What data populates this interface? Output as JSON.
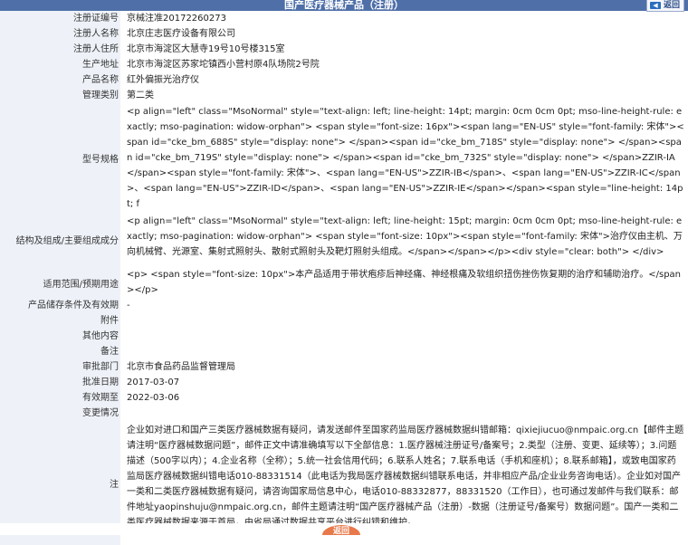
{
  "header": {
    "title": "国产医疗器械产品（注册）",
    "back_label": "返回"
  },
  "fields": {
    "reg_no": {
      "label": "注册证编号",
      "value": "京械注准20172260273"
    },
    "registrant_name": {
      "label": "注册人名称",
      "value": "北京庄志医疗设备有限公司"
    },
    "registrant_address": {
      "label": "注册人住所",
      "value": "北京市海淀区大慧寺19号10号楼315室"
    },
    "production_address": {
      "label": "生产地址",
      "value": "北京市海淀区苏家坨镇西小营村原4队场院2号院"
    },
    "product_name": {
      "label": "产品名称",
      "value": "红外偏振光治疗仪"
    },
    "category": {
      "label": "管理类别",
      "value": "第二类"
    },
    "model": {
      "label": "型号规格",
      "value": "<p align=\"left\" class=\"MsoNormal\" style=\"text-align: left; line-height: 14pt; margin: 0cm 0cm 0pt; mso-line-height-rule: exactly; mso-pagination: widow-orphan\"> <span style=\"font-size: 16px\"><span lang=\"EN-US\" style=\"font-family: 宋体\"><span id=\"cke_bm_688S\" style=\"display: none\"> </span><span id=\"cke_bm_718S\" style=\"display: none\"> </span><span id=\"cke_bm_719S\" style=\"display: none\"> </span><span id=\"cke_bm_732S\" style=\"display: none\"> </span>ZZIR-IA</span><span style=\"font-family: 宋体\">、<span lang=\"EN-US\">ZZIR-IB</span>、<span lang=\"EN-US\">ZZIR-IC</span>、<span lang=\"EN-US\">ZZIR-ID</span>、<span lang=\"EN-US\">ZZIR-IE</span></span><span style=\"line-height: 14pt; f"
    },
    "structure": {
      "label": "结构及组成/主要组成成分",
      "value": "<p align=\"left\" class=\"MsoNormal\" style=\"text-align: left; line-height: 15pt; margin: 0cm 0cm 0pt; mso-line-height-rule: exactly; mso-pagination: widow-orphan\"> <span style=\"font-size: 10px\"><span style=\"font-family: 宋体\">治疗仪由主机、万向机械臂、光源室、集射式照射头、散射式照射头及靶灯照射头组成。</span></span></p><div style=\"clear: both\"> </div>"
    },
    "scope": {
      "label": "适用范围/预期用途",
      "value": "<p> <span style=\"font-size: 10px\">本产品适用于带状疱疹后神经痛、神经根痛及软组织扭伤挫伤恢复期的治疗和辅助治疗。</span></p>"
    },
    "storage": {
      "label": "产品储存条件及有效期",
      "value": "-"
    },
    "attachment": {
      "label": "附件",
      "value": ""
    },
    "other": {
      "label": "其他内容",
      "value": ""
    },
    "remarks": {
      "label": "备注",
      "value": ""
    },
    "approval_dept": {
      "label": "审批部门",
      "value": "北京市食品药品监督管理局"
    },
    "approval_date": {
      "label": "批准日期",
      "value": "2017-03-07"
    },
    "expiry_date": {
      "label": "有效期至",
      "value": "2022-03-06"
    },
    "changes": {
      "label": "变更情况",
      "value": ""
    },
    "note": {
      "label": "注",
      "value": "企业如对进口和国产三类医疗器械数据有疑问，请发送邮件至国家药监局医疗器械数据纠错邮箱：qixiejiucuo@nmpaic.org.cn【邮件主题请注明“医疗器械数据问题”，邮件正文中请准确填写以下全部信息：1.医疗器械注册证号/备案号；2.类型（注册、变更、延续等）；3.问题描述（500字以内）；4.企业名称（全称）；5.统一社会信用代码；6.联系人姓名；7.联系电话（手机和座机）；8.联系邮箱】，或致电国家药监局医疗器械数据纠错电话010-88331514（此电话为我局医疗器械数据纠错联系电话，并非相应产品/企业业务咨询电话）。企业如对国产一类和二类医疗器械数据有疑问，请咨询国家局信息中心，电话010-88332877，88331520（工作日），也可通过发邮件与我们联系：邮件地址yaopinshuju@nmpaic.org.cn，邮件主题请注明“国产医疗器械产品（注册）-数据（注册证号/备案号）数据问题”。国产一类和二类医疗器械数据来源于首局，由省局通过数据共享平台进行纠错和维护。"
    }
  },
  "footer": {
    "back_label": "返回"
  }
}
